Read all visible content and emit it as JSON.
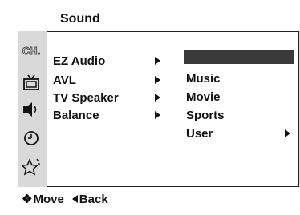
{
  "title": "Sound",
  "icons": [
    "ch-icon",
    "picture-icon",
    "speaker-icon",
    "clock-icon",
    "star-icon"
  ],
  "icon_text": {
    "ch": "CH."
  },
  "menu": [
    {
      "label": "EZ Audio",
      "has_submenu": true
    },
    {
      "label": "AVL",
      "has_submenu": true
    },
    {
      "label": "TV Speaker",
      "has_submenu": true
    },
    {
      "label": "Balance",
      "has_submenu": true
    }
  ],
  "submenu": {
    "highlighted_index": 0,
    "items": [
      {
        "label": "",
        "has_submenu": false
      },
      {
        "label": "Music",
        "has_submenu": false
      },
      {
        "label": "Movie",
        "has_submenu": false
      },
      {
        "label": "Sports",
        "has_submenu": false
      },
      {
        "label": "User",
        "has_submenu": true
      }
    ]
  },
  "footer": {
    "move_label": "Move",
    "back_label": "Back"
  },
  "colors": {
    "frame": "#d9d9d9",
    "highlight": "#3a3a3a",
    "text": "#111111"
  }
}
